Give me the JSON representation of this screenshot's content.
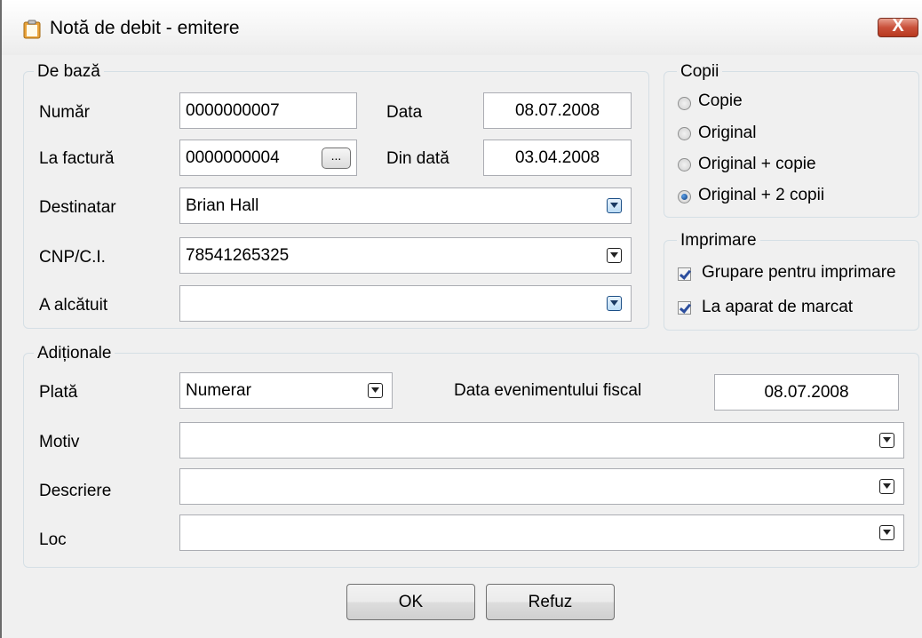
{
  "window": {
    "title": "Notă de debit - emitere",
    "close_label": "X"
  },
  "basic": {
    "legend": "De bază",
    "numar_label": "Număr",
    "numar_value": "0000000007",
    "data_label": "Data",
    "data_value": "08.07.2008",
    "la_factura_label": "La factură",
    "la_factura_value": "0000000004",
    "browse_label": "...",
    "din_data_label": "Din dată",
    "din_data_value": "03.04.2008",
    "destinatar_label": "Destinatar",
    "destinatar_value": "Brian Hall",
    "cnp_label": "CNP/C.I.",
    "cnp_value": "78541265325",
    "alcatuit_label": "A alcătuit",
    "alcatuit_value": ""
  },
  "copies": {
    "legend": "Copii",
    "options": [
      "Copie",
      "Original",
      "Original + copie",
      "Original + 2 copii"
    ],
    "selected_index": 3
  },
  "printing": {
    "legend": "Imprimare",
    "grupare_label": "Grupare pentru imprimare",
    "grupare_checked": true,
    "aparat_label": "La aparat de marcat",
    "aparat_checked": true
  },
  "additional": {
    "legend": "Adiționale",
    "plata_label": "Plată",
    "plata_value": "Numerar",
    "data_fiscal_label": "Data evenimentului fiscal",
    "data_fiscal_value": "08.07.2008",
    "motiv_label": "Motiv",
    "motiv_value": "",
    "descriere_label": "Descriere",
    "descriere_value": "",
    "loc_label": "Loc",
    "loc_value": ""
  },
  "buttons": {
    "ok_label": "OK",
    "cancel_label": "Refuz"
  }
}
